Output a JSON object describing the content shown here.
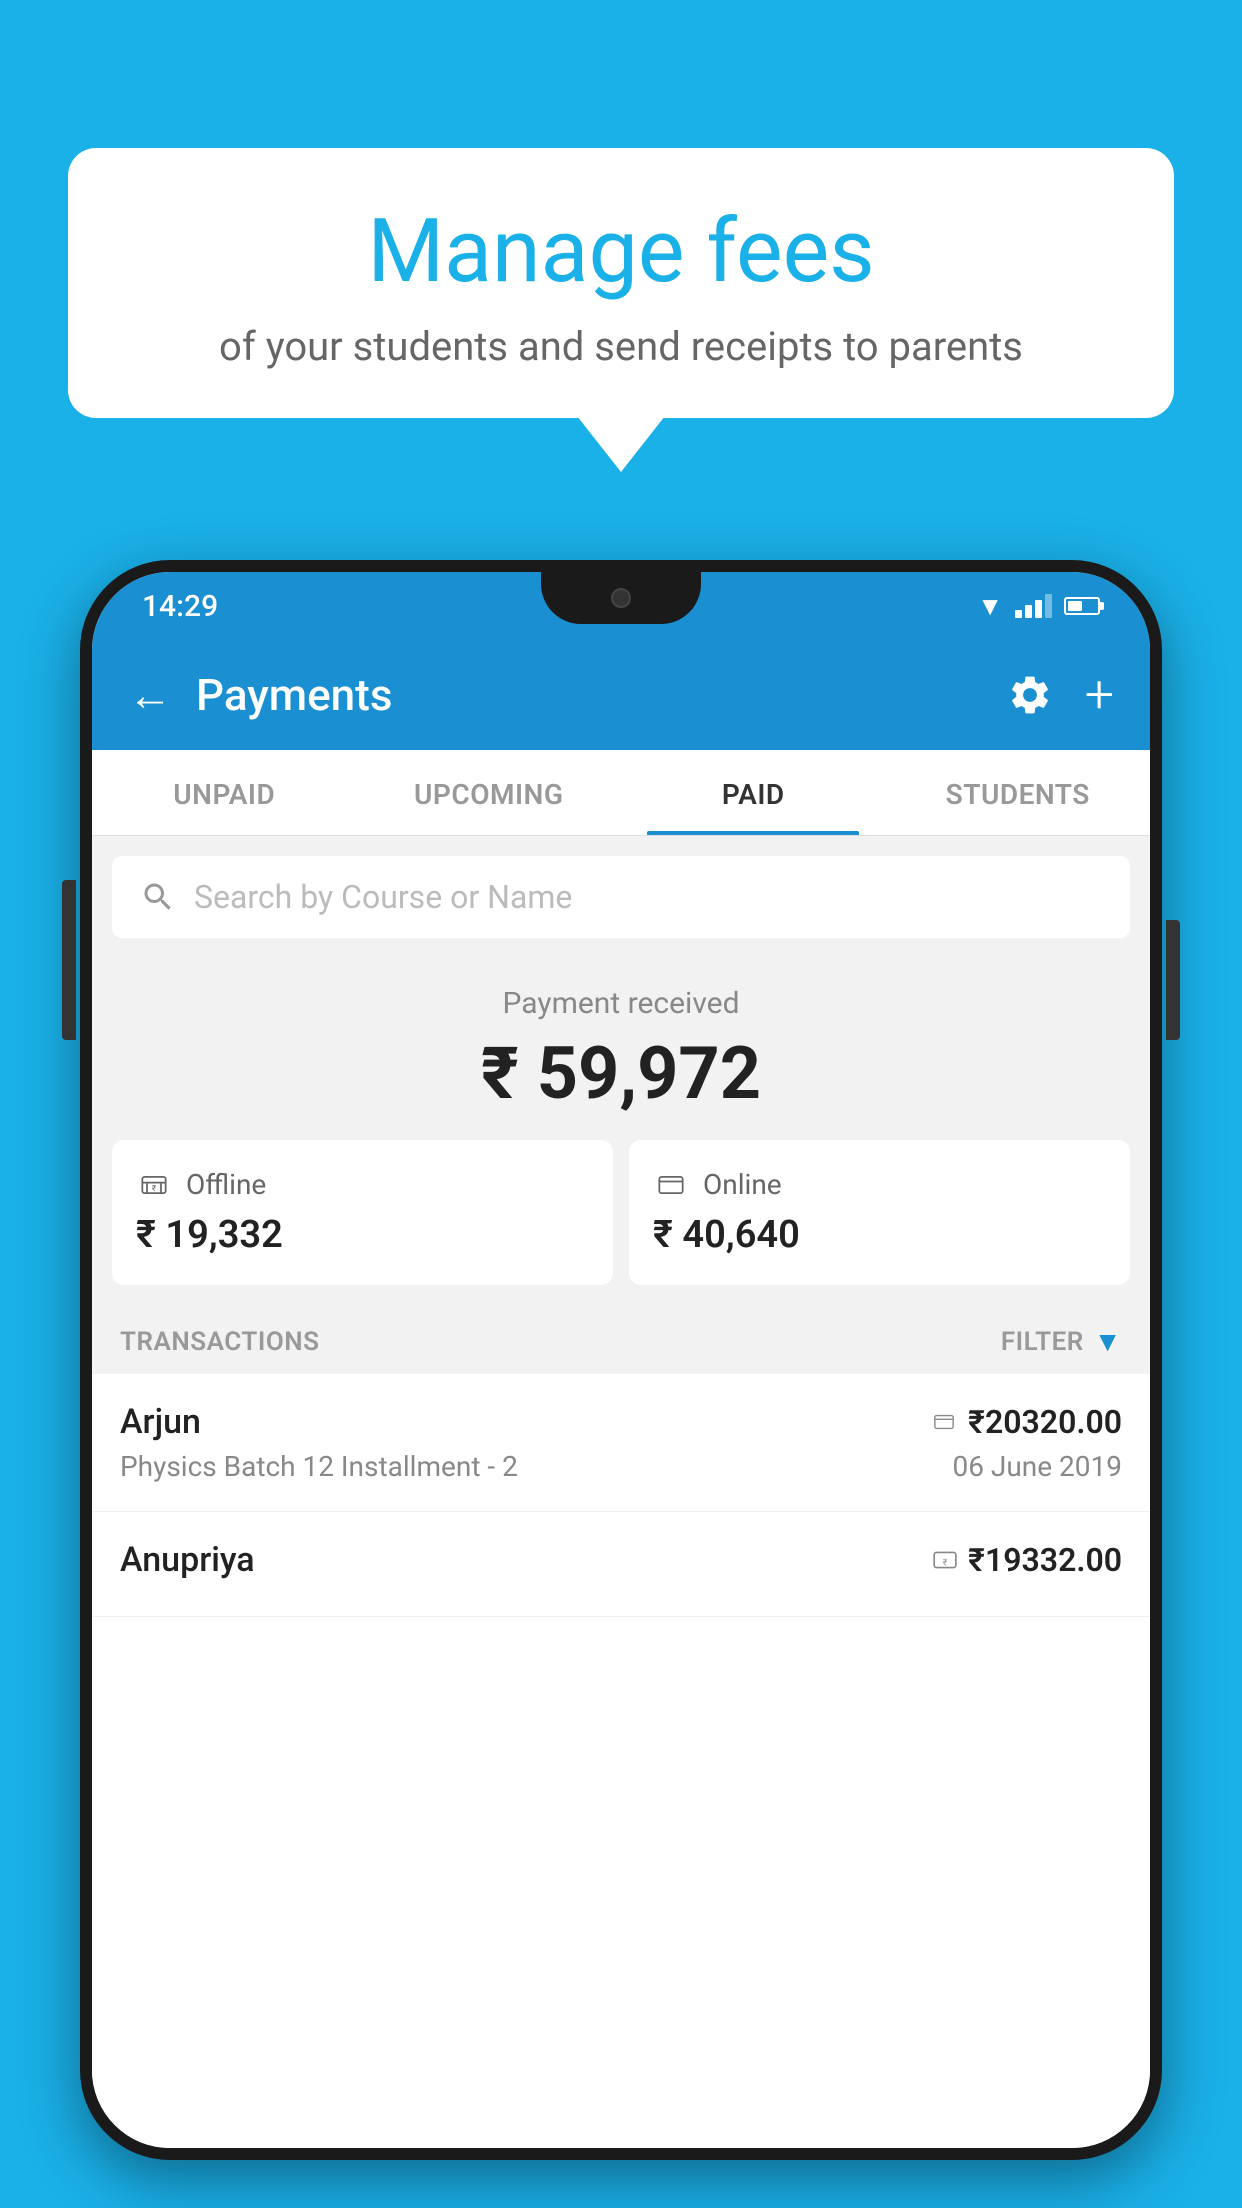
{
  "background_color": "#1ab0e8",
  "bubble": {
    "title": "Manage fees",
    "subtitle": "of your students and send receipts to parents"
  },
  "phone": {
    "status_bar": {
      "time": "14:29"
    },
    "app_bar": {
      "title": "Payments",
      "back_label": "←"
    },
    "tabs": [
      {
        "label": "UNPAID",
        "active": false
      },
      {
        "label": "UPCOMING",
        "active": false
      },
      {
        "label": "PAID",
        "active": true
      },
      {
        "label": "STUDENTS",
        "active": false
      }
    ],
    "search": {
      "placeholder": "Search by Course or Name"
    },
    "payment": {
      "label": "Payment received",
      "amount": "₹ 59,972",
      "offline": {
        "type": "Offline",
        "amount": "₹ 19,332"
      },
      "online": {
        "type": "Online",
        "amount": "₹ 40,640"
      }
    },
    "transactions": {
      "label": "TRANSACTIONS",
      "filter_label": "FILTER",
      "items": [
        {
          "name": "Arjun",
          "amount": "₹20320.00",
          "payment_mode": "card",
          "course": "Physics Batch 12 Installment - 2",
          "date": "06 June 2019"
        },
        {
          "name": "Anupriya",
          "amount": "₹19332.00",
          "payment_mode": "cash",
          "course": "",
          "date": ""
        }
      ]
    }
  }
}
